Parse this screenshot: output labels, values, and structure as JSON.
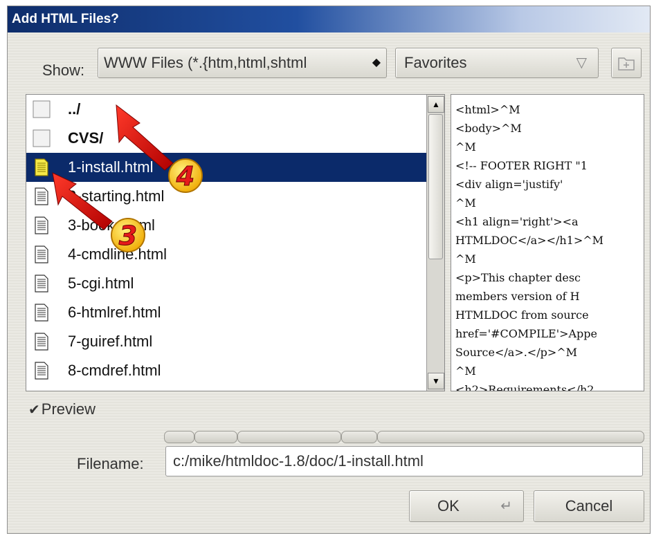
{
  "window": {
    "title": "Add HTML Files?"
  },
  "toolbar": {
    "show_label": "Show:",
    "filter_value": "WWW Files (*.{htm,html,shtml",
    "favorites_label": "Favorites"
  },
  "files": [
    {
      "name": "../",
      "type": "folder",
      "selected": false
    },
    {
      "name": "CVS/",
      "type": "folder",
      "selected": false
    },
    {
      "name": "1-install.html",
      "type": "file",
      "selected": true
    },
    {
      "name": "2-starting.html",
      "type": "file",
      "selected": false
    },
    {
      "name": "3-books.html",
      "type": "file",
      "selected": false
    },
    {
      "name": "4-cmdline.html",
      "type": "file",
      "selected": false
    },
    {
      "name": "5-cgi.html",
      "type": "file",
      "selected": false
    },
    {
      "name": "6-htmlref.html",
      "type": "file",
      "selected": false
    },
    {
      "name": "7-guiref.html",
      "type": "file",
      "selected": false
    },
    {
      "name": "8-cmdref.html",
      "type": "file",
      "selected": false
    }
  ],
  "preview_lines": [
    "<html>^M",
    "<body>^M",
    "^M",
    "<!-- FOOTER RIGHT \"1",
    "<div align='justify'",
    "^M",
    "<h1 align='right'><a",
    "HTMLDOC</a></h1>^M",
    "^M",
    "<p>This chapter desc",
    "members version of H",
    "HTMLDOC from source",
    "href='#COMPILE'>Appe",
    "Source</a>.</p>^M",
    "^M",
    "<h2>Requirements</h2"
  ],
  "preview_toggle": {
    "label": "Preview",
    "checked": true
  },
  "filename": {
    "label": "Filename:",
    "value": "c:/mike/htmldoc-1.8/doc/1-install.html"
  },
  "buttons": {
    "ok": "OK",
    "cancel": "Cancel"
  },
  "annotations": {
    "badge_3": "3",
    "badge_4": "4",
    "arrow_color": "#e01010",
    "badge_color": "#f4c000"
  }
}
